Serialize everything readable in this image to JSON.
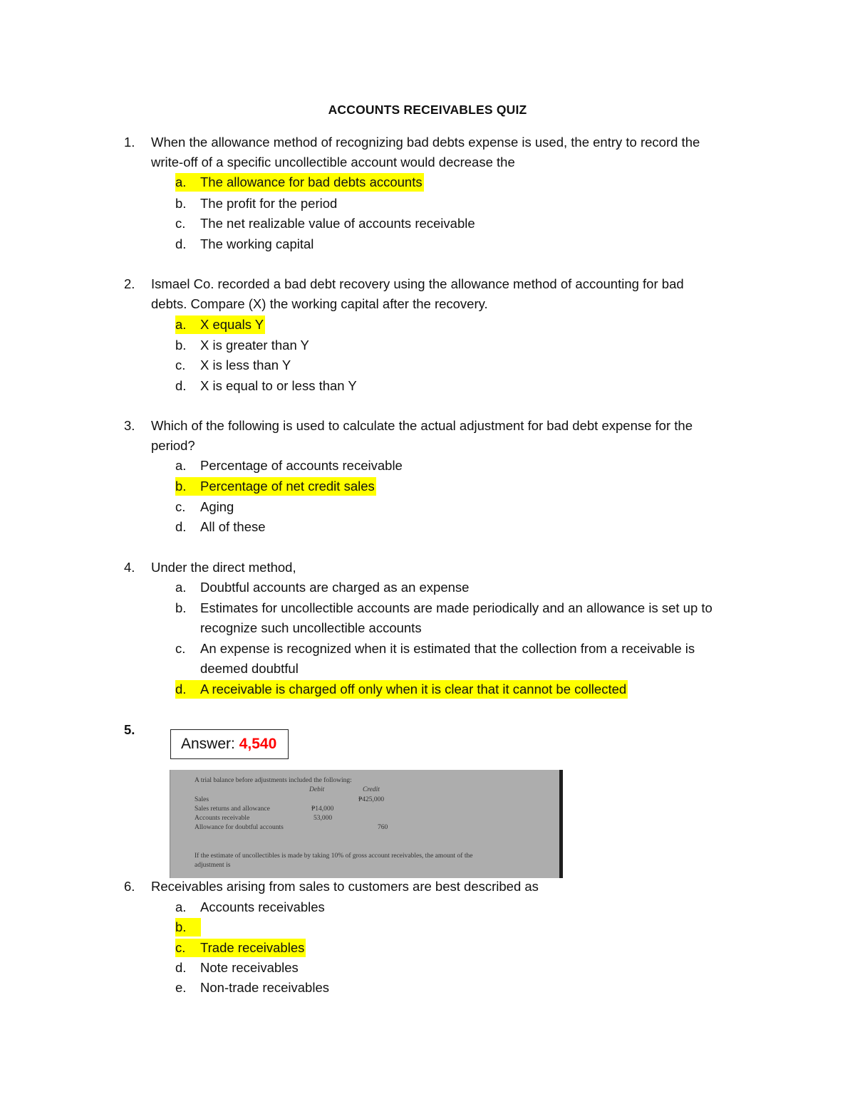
{
  "title": "ACCOUNTS RECEIVABLES QUIZ",
  "highlight_color": "#ffff00",
  "answer_color": "#ff0000",
  "questions": [
    {
      "number": "1.",
      "lines": [
        "When the allowance method of recognizing bad debts expense is used, the entry to record the",
        "write-off of a specific uncollectible account would decrease the"
      ],
      "options": [
        {
          "letter": "a.",
          "text": "The allowance for bad debts accounts",
          "highlighted": true
        },
        {
          "letter": "b.",
          "text": "The profit for the period",
          "highlighted": false
        },
        {
          "letter": "c.",
          "text": "The net realizable value of accounts receivable",
          "highlighted": false
        },
        {
          "letter": "d.",
          "text": "The working capital",
          "highlighted": false
        }
      ]
    },
    {
      "number": "2.",
      "lines": [
        "Ismael Co. recorded a bad debt recovery using the allowance method of accounting for bad",
        "debts. Compare (X) the working capital after the recovery."
      ],
      "options": [
        {
          "letter": "a.",
          "text": "X equals Y",
          "highlighted": true
        },
        {
          "letter": "b.",
          "text": "X is greater than Y",
          "highlighted": false
        },
        {
          "letter": "c.",
          "text": "X is less than Y",
          "highlighted": false
        },
        {
          "letter": "d.",
          "text": "X is equal to or less than Y",
          "highlighted": false
        }
      ]
    },
    {
      "number": "3.",
      "lines": [
        "Which of the following is used to calculate the actual adjustment for bad debt expense for the",
        "period?"
      ],
      "options": [
        {
          "letter": "a.",
          "text": "Percentage of accounts receivable",
          "highlighted": false
        },
        {
          "letter": "b.",
          "text": "Percentage of net credit sales",
          "highlighted": true
        },
        {
          "letter": "c.",
          "text": "Aging",
          "highlighted": false
        },
        {
          "letter": "d.",
          "text": "All of these",
          "highlighted": false
        }
      ]
    },
    {
      "number": "4.",
      "lines": [
        "Under the direct method,"
      ],
      "options": [
        {
          "letter": "a.",
          "text": "Doubtful accounts are charged as an expense",
          "highlighted": false
        },
        {
          "letter": "b.",
          "text": "Estimates for uncollectible accounts are made periodically and an allowance is set up to",
          "text2": "recognize such uncollectible accounts",
          "highlighted": false
        },
        {
          "letter": "c.",
          "text": "An expense is recognized when it is estimated that the collection from a receivable is",
          "text2": "deemed doubtful",
          "highlighted": false
        },
        {
          "letter": "d.",
          "text": "A receivable is charged off only when it is clear that it cannot be collected",
          "highlighted": true
        }
      ]
    },
    {
      "number": "5.",
      "answer_label": "Answer:",
      "answer_value": "4,540",
      "image": {
        "intro": "A trial balance before adjustments included the following:",
        "col_debit": "Debit",
        "col_credit": "Credit",
        "rows": [
          {
            "label": "Sales",
            "debit": "",
            "credit": "₱425,000"
          },
          {
            "label": "Sales returns and allowance",
            "debit": "₱14,000",
            "credit": ""
          },
          {
            "label": "Accounts receivable",
            "debit": "53,000",
            "credit": ""
          },
          {
            "label": "Allowance for doubtful accounts",
            "debit": "",
            "credit": "760"
          }
        ],
        "question_line1": "If the estimate of uncollectibles is made by taking 10% of gross account receivables, the amount of the",
        "question_line2": "adjustment is"
      }
    },
    {
      "number": "6.",
      "lines": [
        "Receivables arising from sales to customers are best described as"
      ],
      "options": [
        {
          "letter": "a.",
          "text": "Accounts receivables",
          "highlighted": false
        },
        {
          "letter": "b.",
          "text": "",
          "highlighted": true
        },
        {
          "letter": "c.",
          "text": "Trade receivables",
          "highlighted": true
        },
        {
          "letter": "d.",
          "text": "Note receivables",
          "highlighted": false
        },
        {
          "letter": "e.",
          "text": "Non-trade receivables",
          "highlighted": false
        }
      ]
    }
  ]
}
